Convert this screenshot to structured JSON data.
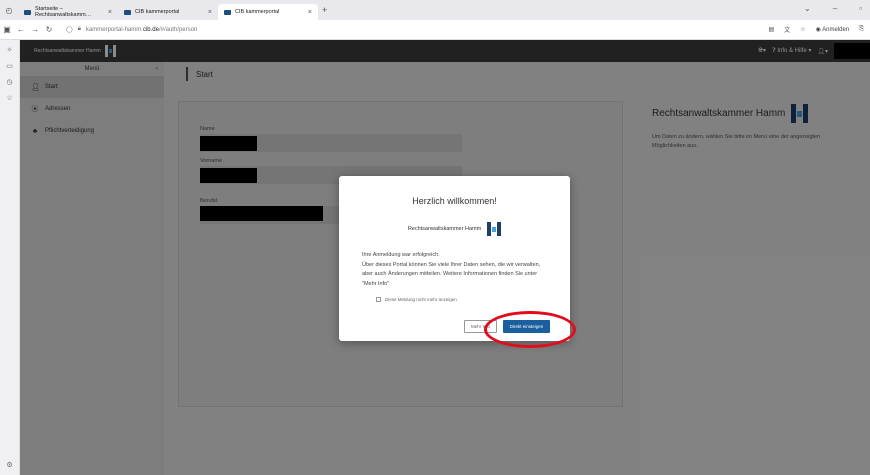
{
  "browser": {
    "tabs": [
      {
        "label": "Startseite – Rechtsanwaltskamm…",
        "active": false
      },
      {
        "label": "CIB kammerportal",
        "active": false
      },
      {
        "label": "CIB kammerportal",
        "active": true
      }
    ],
    "url_prefix": "kammerportal-hamm.",
    "url_host": "cib.de",
    "url_suffix": "/#/auth/person",
    "signin_label": "Anmelden"
  },
  "app": {
    "brand": "Rechtsanwaltskammer Hamm",
    "help_label": "Info & Hilfe"
  },
  "sidebar": {
    "menu_title": "Menü",
    "items": [
      {
        "label": "Start",
        "icon": "user-icon",
        "active": true
      },
      {
        "label": "Adressen",
        "icon": "location-icon",
        "active": false
      },
      {
        "label": "Pflichtverteidigung",
        "icon": "sitemap-icon",
        "active": false
      }
    ]
  },
  "page": {
    "title": "Start",
    "fields": [
      {
        "label": "Name"
      },
      {
        "label": "Vorname"
      },
      {
        "label": "Berufsl."
      }
    ]
  },
  "info_panel": {
    "title": "Rechtsanwaltskammer Hamm",
    "text": "Um Daten zu ändern, wählen Sie bitte im Menü eine der angezeigten Möglichkeiten aus."
  },
  "modal": {
    "title": "Herzlich willkommen!",
    "org": "Rechtsanwaltskammer Hamm",
    "line1": "Ihre Anmeldung war erfolgreich.",
    "line2": "Über dieses Portal können Sie viele Ihrer Daten sehen, die wir verwalten, aber auch Änderungen mitteilen. Weitere Informationen finden Sie unter \"Mehr Info\"",
    "checkbox_label": "Diese Meldung nicht mehr anzeigen",
    "more_button": "Mehr Info",
    "direct_button": "Direkt einsteigen"
  },
  "colors": {
    "primary": "#1b5f9e",
    "header": "#3d3d3d",
    "annotation": "#e10d1c"
  }
}
